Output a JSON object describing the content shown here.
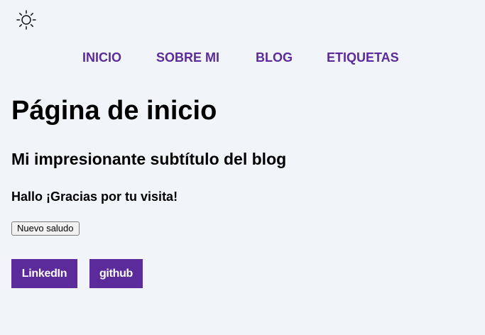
{
  "theme_toggle": {
    "icon": "sun-icon"
  },
  "nav": {
    "items": [
      {
        "label": "INICIO"
      },
      {
        "label": "SOBRE MI"
      },
      {
        "label": "BLOG"
      },
      {
        "label": "ETIQUETAS"
      }
    ],
    "color": "#5b2a9b"
  },
  "main": {
    "title": "Página de inicio",
    "subtitle": "Mi impresionante subtítulo del blog",
    "greeting": "Hallo ¡Gracias por tu visita!",
    "greet_button_label": "Nuevo saludo"
  },
  "social": {
    "links": [
      {
        "label": "LinkedIn"
      },
      {
        "label": "github"
      }
    ],
    "color": "#5b2a9b"
  },
  "colors": {
    "background": "#f1f4f9",
    "accent": "#5b2a9b"
  }
}
